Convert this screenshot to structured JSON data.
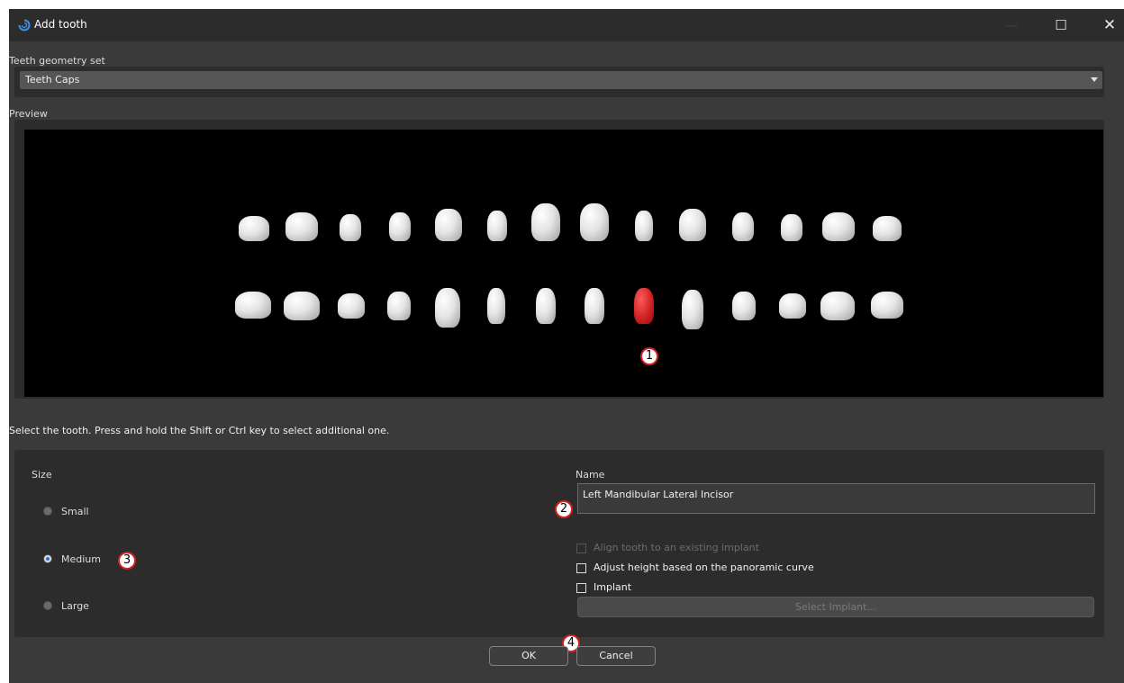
{
  "window": {
    "title": "Add tooth",
    "controls": {
      "minimize": "—",
      "maximize": "☐",
      "close": "✕"
    }
  },
  "geometry": {
    "label": "Teeth geometry set",
    "selected": "Teeth Caps"
  },
  "preview": {
    "label": "Preview",
    "upper_row_count": 14,
    "lower_row_count": 14,
    "selected_tooth": "lower row, 9th from left",
    "selected_color": "#cc1f1f"
  },
  "instruction": "Select the tooth. Press and hold the Shift or Ctrl key to select additional one.",
  "size": {
    "label": "Size",
    "options": [
      "Small",
      "Medium",
      "Large"
    ],
    "selected": "Medium"
  },
  "name": {
    "label": "Name",
    "value": "Left Mandibular Lateral Incisor"
  },
  "options": {
    "align_implant": "Align tooth to an existing implant",
    "adjust_height": "Adjust height based on the panoramic curve",
    "implant": "Implant"
  },
  "select_implant_label": "Select Implant...",
  "buttons": {
    "ok": "OK",
    "cancel": "Cancel"
  },
  "callouts": {
    "c1": "1",
    "c2": "2",
    "c3": "3",
    "c4": "4"
  }
}
